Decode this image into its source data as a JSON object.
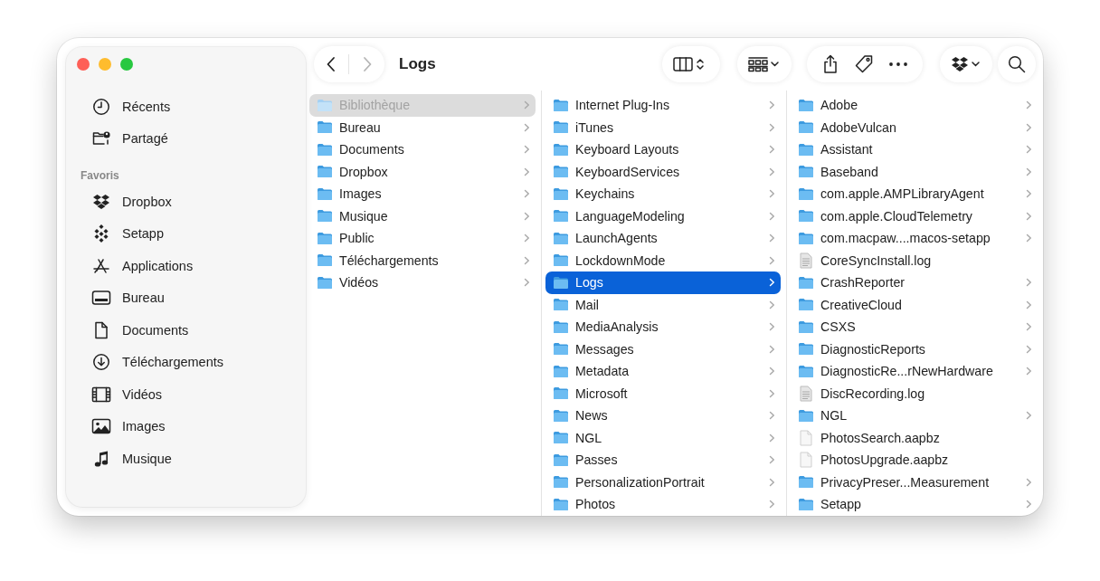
{
  "sidebar": {
    "items": [
      {
        "label": "Récents",
        "kind": "recents",
        "selected": false
      },
      {
        "label": "Partagé",
        "kind": "shared",
        "selected": false
      }
    ],
    "sections": [
      {
        "title": "Favoris",
        "items": [
          {
            "label": "Dropbox",
            "kind": "dropbox",
            "selected": false
          },
          {
            "label": "Setapp",
            "kind": "setapp",
            "selected": false
          },
          {
            "label": "Applications",
            "kind": "applications",
            "selected": false
          },
          {
            "label": "Bureau",
            "kind": "desktop",
            "selected": false
          },
          {
            "label": "Documents",
            "kind": "document",
            "selected": false
          },
          {
            "label": "Téléchargements",
            "kind": "download",
            "selected": false
          },
          {
            "label": "Vidéos",
            "kind": "film",
            "selected": false
          },
          {
            "label": "Images",
            "kind": "photo",
            "selected": false
          },
          {
            "label": "Musique",
            "kind": "music",
            "selected": false
          }
        ]
      }
    ]
  },
  "toolbar": {
    "back": {
      "disabled": false
    },
    "forward": {
      "disabled": true
    },
    "title": "Logs",
    "groups": [
      {
        "buttons": [
          {
            "kind": "view_columns"
          }
        ]
      },
      {
        "buttons": [
          {
            "kind": "group"
          }
        ]
      },
      {
        "buttons": [
          {
            "kind": "share"
          },
          {
            "kind": "tag"
          },
          {
            "kind": "more"
          }
        ]
      },
      {
        "buttons": [
          {
            "kind": "dropbox"
          }
        ]
      },
      {
        "buttons": [
          {
            "kind": "search"
          }
        ]
      }
    ]
  },
  "columns": [
    {
      "active": false,
      "items": [
        {
          "name": "Bibliothèque",
          "kind": "hidden_folder",
          "selected": true
        },
        {
          "name": "Bureau",
          "kind": "folder",
          "selected": false
        },
        {
          "name": "Documents",
          "kind": "folder",
          "selected": false
        },
        {
          "name": "Dropbox",
          "kind": "folder",
          "selected": false
        },
        {
          "name": "Images",
          "kind": "folder",
          "selected": false
        },
        {
          "name": "Musique",
          "kind": "folder",
          "selected": false
        },
        {
          "name": "Public",
          "kind": "folder",
          "selected": false
        },
        {
          "name": "Téléchargements",
          "kind": "folder",
          "selected": false
        },
        {
          "name": "Vidéos",
          "kind": "folder",
          "selected": false
        }
      ]
    },
    {
      "active": true,
      "items": [
        {
          "name": "Internet Plug-Ins",
          "kind": "folder",
          "selected": false
        },
        {
          "name": "iTunes",
          "kind": "folder",
          "selected": false
        },
        {
          "name": "Keyboard Layouts",
          "kind": "folder",
          "selected": false
        },
        {
          "name": "KeyboardServices",
          "kind": "folder",
          "selected": false
        },
        {
          "name": "Keychains",
          "kind": "folder",
          "selected": false
        },
        {
          "name": "LanguageModeling",
          "kind": "folder",
          "selected": false
        },
        {
          "name": "LaunchAgents",
          "kind": "folder",
          "selected": false
        },
        {
          "name": "LockdownMode",
          "kind": "folder",
          "selected": false
        },
        {
          "name": "Logs",
          "kind": "folder",
          "selected": true
        },
        {
          "name": "Mail",
          "kind": "folder",
          "selected": false
        },
        {
          "name": "MediaAnalysis",
          "kind": "folder",
          "selected": false
        },
        {
          "name": "Messages",
          "kind": "folder",
          "selected": false
        },
        {
          "name": "Metadata",
          "kind": "folder",
          "selected": false
        },
        {
          "name": "Microsoft",
          "kind": "folder",
          "selected": false
        },
        {
          "name": "News",
          "kind": "folder",
          "selected": false
        },
        {
          "name": "NGL",
          "kind": "folder",
          "selected": false
        },
        {
          "name": "Passes",
          "kind": "folder",
          "selected": false
        },
        {
          "name": "PersonalizationPortrait",
          "kind": "folder",
          "selected": false
        },
        {
          "name": "Photos",
          "kind": "folder",
          "selected": false
        }
      ]
    },
    {
      "items": [
        {
          "name": "Adobe",
          "kind": "folder",
          "selected": false
        },
        {
          "name": "AdobeVulcan",
          "kind": "folder",
          "selected": false
        },
        {
          "name": "Assistant",
          "kind": "folder",
          "selected": false
        },
        {
          "name": "Baseband",
          "kind": "folder",
          "selected": false
        },
        {
          "name": "com.apple.AMPLibraryAgent",
          "kind": "folder",
          "selected": false
        },
        {
          "name": "com.apple.CloudTelemetry",
          "kind": "folder",
          "selected": false
        },
        {
          "name": "com.macpaw....macos-setapp",
          "kind": "folder",
          "selected": false
        },
        {
          "name": "CoreSyncInstall.log",
          "kind": "log",
          "selected": false
        },
        {
          "name": "CrashReporter",
          "kind": "folder",
          "selected": false
        },
        {
          "name": "CreativeCloud",
          "kind": "folder",
          "selected": false
        },
        {
          "name": "CSXS",
          "kind": "folder",
          "selected": false
        },
        {
          "name": "DiagnosticReports",
          "kind": "folder",
          "selected": false
        },
        {
          "name": "DiagnosticRe...rNewHardware",
          "kind": "folder",
          "selected": false
        },
        {
          "name": "DiscRecording.log",
          "kind": "log",
          "selected": false
        },
        {
          "name": "NGL",
          "kind": "folder",
          "selected": false
        },
        {
          "name": "PhotosSearch.aapbz",
          "kind": "file",
          "selected": false
        },
        {
          "name": "PhotosUpgrade.aapbz",
          "kind": "file",
          "selected": false
        },
        {
          "name": "PrivacyPreser...Measurement",
          "kind": "folder",
          "selected": false
        },
        {
          "name": "Setapp",
          "kind": "folder",
          "selected": false
        }
      ]
    }
  ]
}
